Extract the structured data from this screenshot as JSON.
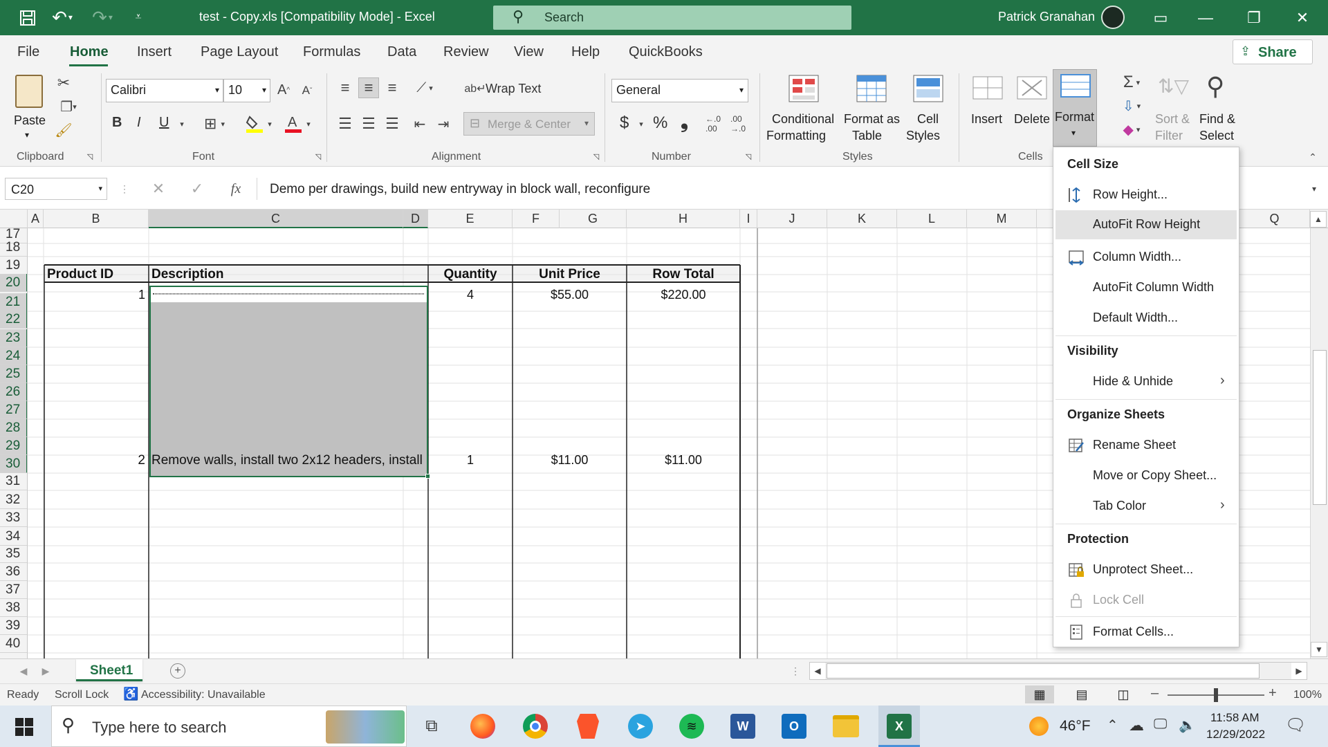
{
  "window": {
    "title": "test - Copy.xls  [Compatibility Mode]  -  Excel",
    "search_placeholder": "Search",
    "user_name": "Patrick Granahan"
  },
  "menu_tabs": [
    "File",
    "Home",
    "Insert",
    "Page Layout",
    "Formulas",
    "Data",
    "Review",
    "View",
    "Help",
    "QuickBooks"
  ],
  "share_label": "Share",
  "ribbon": {
    "clipboard": {
      "paste": "Paste",
      "group": "Clipboard"
    },
    "font": {
      "name": "Calibri",
      "size": "10",
      "group": "Font",
      "bold": "B",
      "italic": "I",
      "underline": "U"
    },
    "alignment": {
      "wrap_text": "Wrap Text",
      "merge_center": "Merge & Center",
      "group": "Alignment"
    },
    "number": {
      "format": "General",
      "group": "Number",
      "currency": "$",
      "percent": "%",
      "comma": "❟"
    },
    "styles": {
      "conditional_1": "Conditional",
      "conditional_2": "Formatting",
      "format_table_1": "Format as",
      "format_table_2": "Table",
      "cell_styles_1": "Cell",
      "cell_styles_2": "Styles",
      "group": "Styles"
    },
    "cells": {
      "insert": "Insert",
      "delete": "Delete",
      "format": "Format",
      "group": "Cells"
    },
    "editing": {
      "sort_1": "Sort &",
      "sort_2": "Filter",
      "find_1": "Find &",
      "find_2": "Select"
    }
  },
  "formula_bar": {
    "name_box": "C20",
    "fx": "fx",
    "content": "Demo per drawings, build new entryway in block wall, reconfigure"
  },
  "columns": [
    "A",
    "B",
    "C",
    "D",
    "E",
    "F",
    "G",
    "H",
    "I",
    "J",
    "K",
    "L",
    "M",
    "Q"
  ],
  "rows": [
    "17",
    "18",
    "19",
    "20",
    "21",
    "22",
    "23",
    "24",
    "25",
    "26",
    "27",
    "28",
    "29",
    "30",
    "31",
    "32",
    "33",
    "34",
    "35",
    "36",
    "37",
    "38",
    "39",
    "40"
  ],
  "table": {
    "headers": [
      "Product ID",
      "Description",
      "Quantity",
      "Unit Price",
      "Row Total"
    ],
    "rows": [
      {
        "id": "1",
        "description": "",
        "quantity": "4",
        "unit_price": "$55.00",
        "row_total": "$220.00"
      },
      {
        "id": "2",
        "description": "Remove walls, install two 2x12 headers, install",
        "quantity": "1",
        "unit_price": "$11.00",
        "row_total": "$11.00"
      }
    ]
  },
  "format_menu": {
    "sections": [
      {
        "header": "Cell Size",
        "items": [
          "Row Height...",
          "AutoFit Row Height",
          "Column Width...",
          "AutoFit Column Width",
          "Default Width..."
        ]
      },
      {
        "header": "Visibility",
        "items": [
          "Hide & Unhide"
        ]
      },
      {
        "header": "Organize Sheets",
        "items": [
          "Rename Sheet",
          "Move or Copy Sheet...",
          "Tab Color"
        ]
      },
      {
        "header": "Protection",
        "items": [
          "Unprotect Sheet...",
          "Lock Cell",
          "Format Cells..."
        ]
      }
    ],
    "highlighted_item": "AutoFit Row Height"
  },
  "sheet_tabs": [
    "Sheet1"
  ],
  "status_bar": {
    "ready": "Ready",
    "scroll_lock": "Scroll Lock",
    "accessibility": "Accessibility: Unavailable",
    "zoom": "100%"
  },
  "taskbar": {
    "search_placeholder": "Type here to search",
    "weather": "46°F",
    "time": "11:58 AM",
    "date": "12/29/2022"
  },
  "colors": {
    "excel_green": "#217346",
    "selection": "#c0c0c0",
    "menu_highlight": "#e3e3e3"
  }
}
